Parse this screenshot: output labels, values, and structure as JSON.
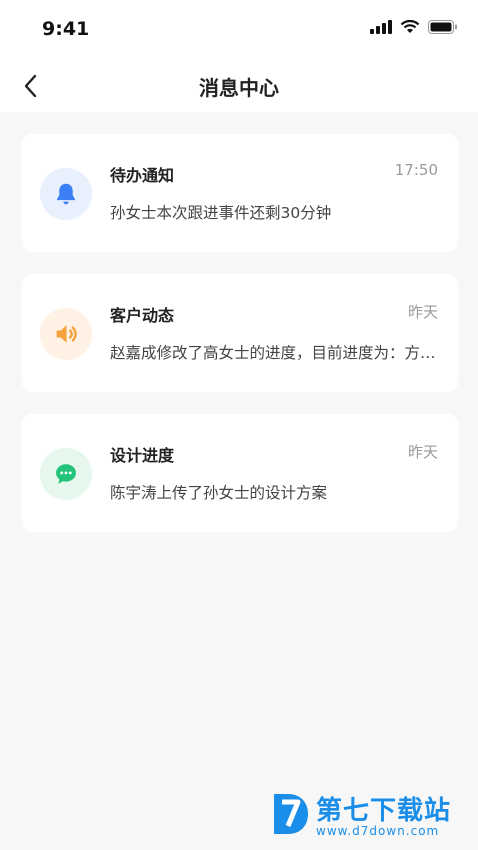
{
  "status_bar": {
    "time": "9:41"
  },
  "nav": {
    "title": "消息中心"
  },
  "messages": [
    {
      "title": "待办通知",
      "time": "17:50",
      "desc": "孙女士本次跟进事件还剩30分钟",
      "icon": "bell-icon",
      "accent": "#3d7ff5",
      "bg": "#e8f0fe"
    },
    {
      "title": "客户动态",
      "time": "昨天",
      "desc": "赵嘉成修改了高女士的进度，目前进度为：方案设计中",
      "icon": "speaker-icon",
      "accent": "#f5a23d",
      "bg": "#fff1e4"
    },
    {
      "title": "设计进度",
      "time": "昨天",
      "desc": "陈宇涛上传了孙女士的设计方案",
      "icon": "chat-bubble-icon",
      "accent": "#23c47a",
      "bg": "#e6f8ee"
    }
  ],
  "watermark": {
    "name": "第七下载站",
    "url": "www.d7down.com"
  }
}
